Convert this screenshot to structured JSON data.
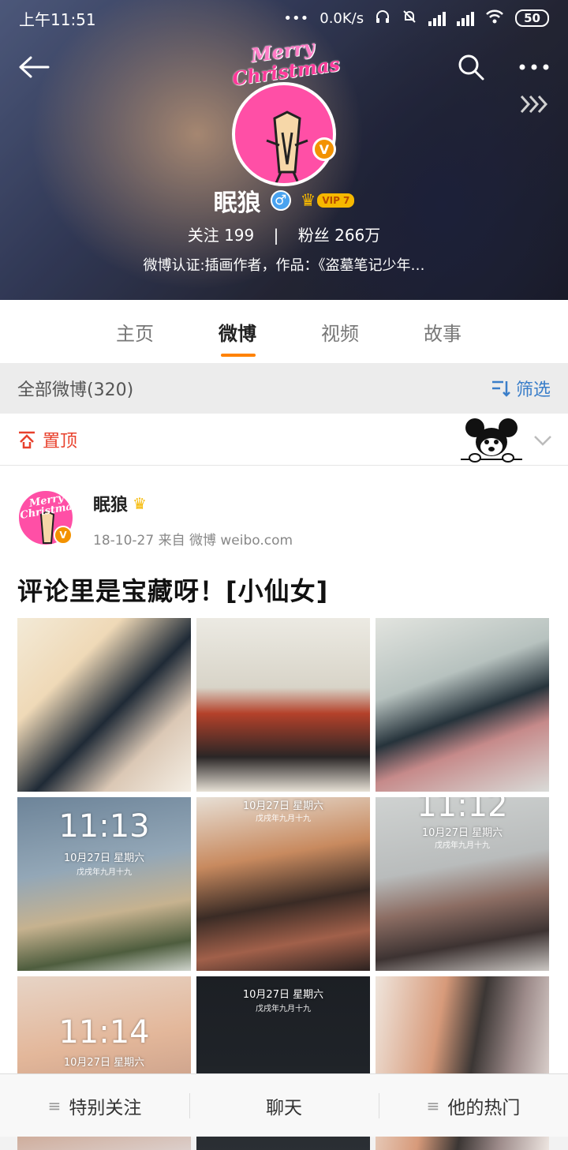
{
  "status_bar": {
    "time": "上午11:51",
    "speed": "0.0K/s",
    "battery": "50"
  },
  "profile": {
    "name": "眠狼",
    "vip": "VIP 7",
    "following_label": "关注",
    "following": "199",
    "fans_label": "粉丝",
    "fans": "266万",
    "description": "微博认证:插画作者，作品：《盗墓笔记少年…",
    "avatar_text_1": "Merry",
    "avatar_text_2": "Christmas",
    "verified": "V"
  },
  "tabs": [
    "主页",
    "微博",
    "视频",
    "故事"
  ],
  "filter": {
    "count_label": "全部微博(320)",
    "filter_label": "筛选"
  },
  "pinned": {
    "label": "置顶"
  },
  "post": {
    "author": "眠狼",
    "meta": "18-10-27  来自 微博 weibo.com",
    "text": "评论里是宝藏呀！[小仙女]",
    "images": [
      {
        "clock": "",
        "date": "",
        "lunar": ""
      },
      {
        "clock": "",
        "date": "",
        "lunar": ""
      },
      {
        "clock": "",
        "date": "",
        "lunar": ""
      },
      {
        "clock": "11:13",
        "date": "10月27日 星期六",
        "lunar": "戊戌年九月十九"
      },
      {
        "clock": "",
        "date": "10月27日 星期六",
        "lunar": "戊戌年九月十九"
      },
      {
        "clock": "11:12",
        "date": "10月27日 星期六",
        "lunar": "戊戌年九月十九"
      },
      {
        "clock": "11:14",
        "date": "10月27日 星期六",
        "lunar": ""
      },
      {
        "clock": "",
        "date": "10月27日 星期六",
        "lunar": "戊戌年九月十九"
      },
      {
        "clock": "",
        "date": "",
        "lunar": ""
      }
    ]
  },
  "bottom_bar": {
    "special_follow": "特别关注",
    "chat": "聊天",
    "hot": "他的热门"
  }
}
